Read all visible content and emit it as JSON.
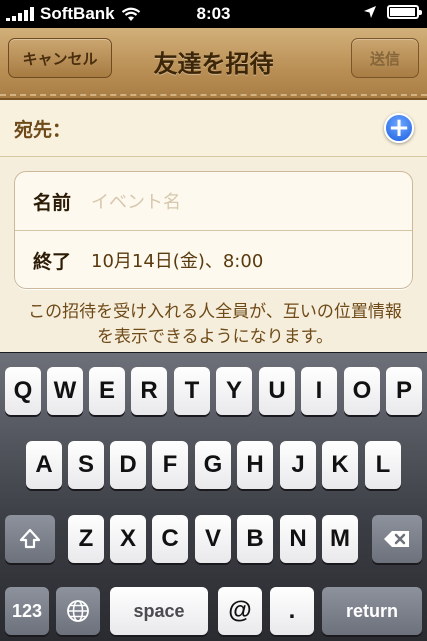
{
  "status": {
    "carrier": "SoftBank",
    "time": "8:03",
    "battery_level": 0.95
  },
  "navbar": {
    "cancel_label": "キャンセル",
    "title": "友達を招待",
    "send_label": "送信"
  },
  "recipient": {
    "label": "宛先："
  },
  "form": {
    "name_label": "名前",
    "name_placeholder": "イベント名",
    "end_label": "終了",
    "end_value": "10月14日(金)、8:00"
  },
  "note": "この招待を受け入れる人全員が、互いの位置情報を表示できるようになります。",
  "keyboard": {
    "row1": [
      "Q",
      "W",
      "E",
      "R",
      "T",
      "Y",
      "U",
      "I",
      "O",
      "P"
    ],
    "row2": [
      "A",
      "S",
      "D",
      "F",
      "G",
      "H",
      "J",
      "K",
      "L"
    ],
    "row3": [
      "Z",
      "X",
      "C",
      "V",
      "B",
      "N",
      "M"
    ],
    "numbers_label": "123",
    "space_label": "space",
    "at_label": "@",
    "dot_label": ".",
    "return_label": "return"
  }
}
